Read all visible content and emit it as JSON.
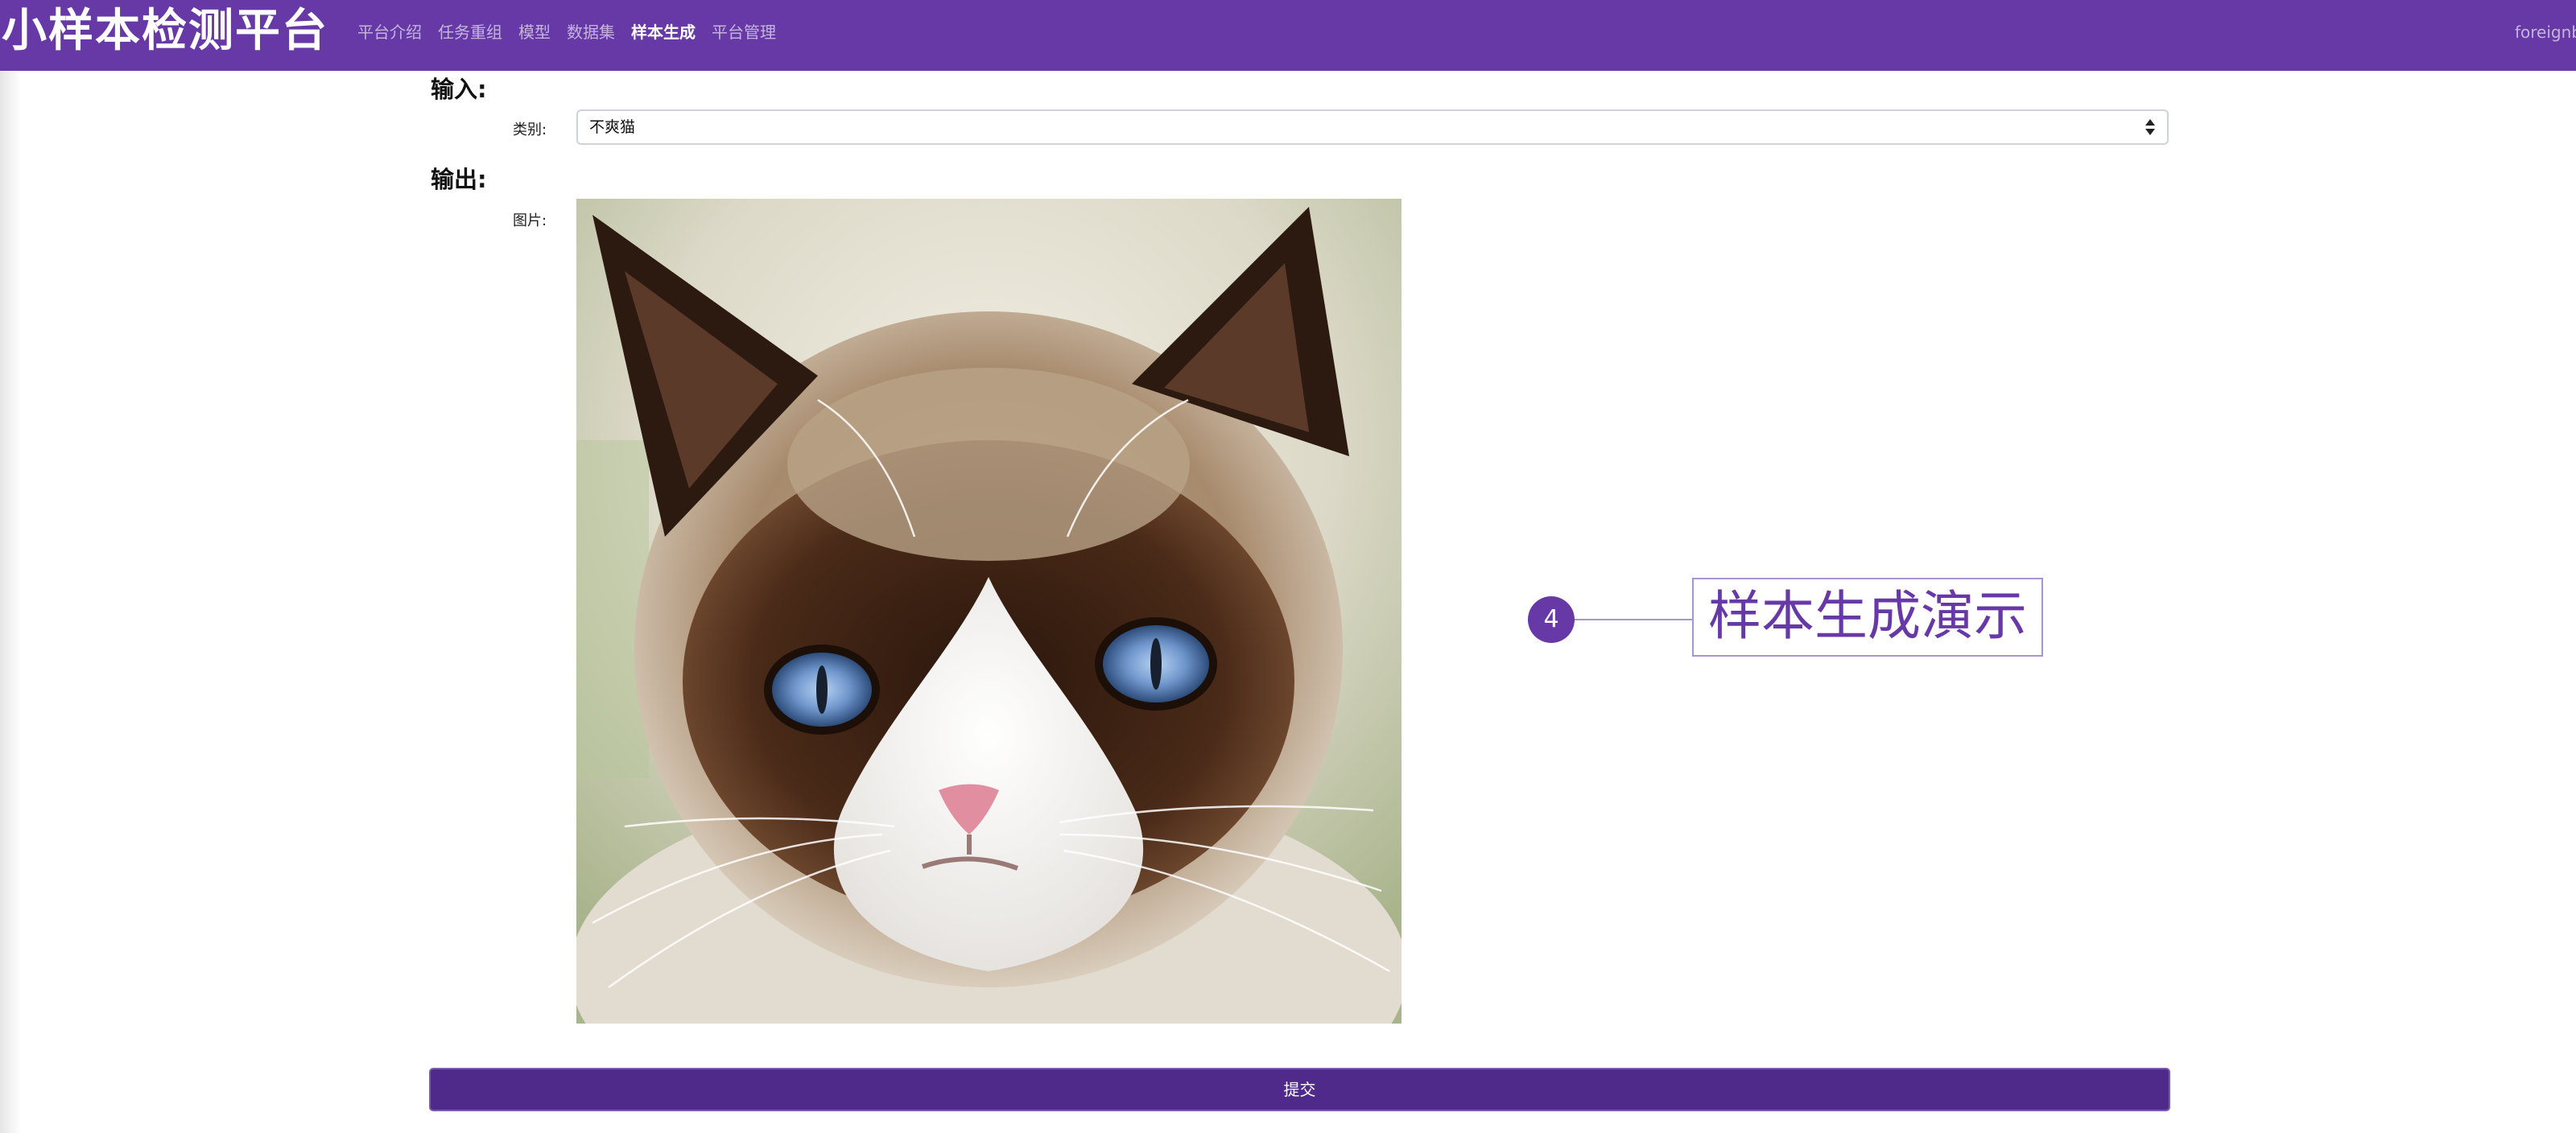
{
  "navbar": {
    "brand": "小样本检测平台",
    "links": [
      {
        "label": "平台介绍",
        "active": false
      },
      {
        "label": "任务重组",
        "active": false
      },
      {
        "label": "模型",
        "active": false
      },
      {
        "label": "数据集",
        "active": false
      },
      {
        "label": "样本生成",
        "active": true
      },
      {
        "label": "平台管理",
        "active": false
      }
    ],
    "user": "foreignb"
  },
  "form": {
    "input_title": "输入:",
    "category_label": "类别:",
    "category_value": "不爽猫",
    "output_title": "输出:",
    "image_label": "图片:",
    "submit_label": "提交"
  },
  "annotation": {
    "badge": "4",
    "label": "样本生成演示"
  },
  "colors": {
    "navbar": "#6639a6",
    "submit": "#4f2a8a",
    "callout": "#6639a6"
  }
}
